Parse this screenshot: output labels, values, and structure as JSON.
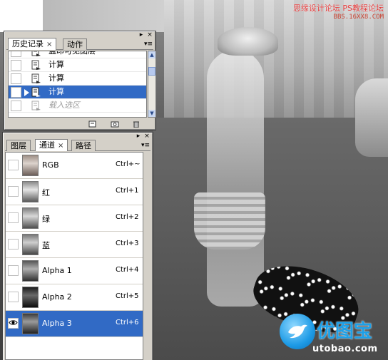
{
  "watermarks": {
    "top_line1": "思缘设计论坛 PS教程论坛",
    "top_line2": "BBS.16XX8.COM",
    "brand": "优图宝",
    "url": "utobao.com",
    "icon": "bird-icon"
  },
  "history_panel": {
    "tabs": [
      {
        "label": "历史记录",
        "active": true
      },
      {
        "label": "动作",
        "active": false
      }
    ],
    "close_glyph": "×",
    "menu_glyph": "▾≡",
    "items": [
      {
        "label": "盖印可见图层",
        "state": "normal",
        "icon": "history-step-icon"
      },
      {
        "label": "计算",
        "state": "normal",
        "icon": "history-step-icon"
      },
      {
        "label": "计算",
        "state": "normal",
        "icon": "history-step-icon"
      },
      {
        "label": "计算",
        "state": "selected",
        "icon": "history-step-icon"
      },
      {
        "label": "载入选区",
        "state": "dim",
        "icon": "history-step-icon"
      }
    ],
    "footer_icons": [
      "new-document-icon",
      "snapshot-icon",
      "trash-icon"
    ]
  },
  "channels_panel": {
    "tabs": [
      {
        "label": "图层",
        "active": false
      },
      {
        "label": "通道",
        "active": true
      },
      {
        "label": "路径",
        "active": false
      }
    ],
    "close_glyph": "×",
    "channels": [
      {
        "name": "RGB",
        "shortcut": "Ctrl+~",
        "visible": false,
        "selected": false
      },
      {
        "name": "红",
        "shortcut": "Ctrl+1",
        "visible": false,
        "selected": false
      },
      {
        "name": "绿",
        "shortcut": "Ctrl+2",
        "visible": false,
        "selected": false
      },
      {
        "name": "蓝",
        "shortcut": "Ctrl+3",
        "visible": false,
        "selected": false
      },
      {
        "name": "Alpha 1",
        "shortcut": "Ctrl+4",
        "visible": false,
        "selected": false
      },
      {
        "name": "Alpha 2",
        "shortcut": "Ctrl+5",
        "visible": false,
        "selected": false
      },
      {
        "name": "Alpha 3",
        "shortcut": "Ctrl+6",
        "visible": true,
        "selected": true
      }
    ],
    "eye_glyph": "👁"
  },
  "colors": {
    "selection": "#316ac5",
    "panel_bg": "#d4d0c8",
    "watermark_red": "#e43b3b",
    "brand_blue": "#1da0e8"
  }
}
